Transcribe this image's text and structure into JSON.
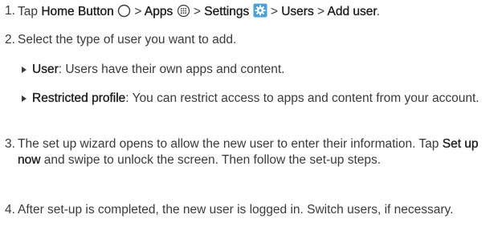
{
  "steps": [
    {
      "number": "1.",
      "parts": {
        "t1": "Tap ",
        "home_button": "Home Button",
        "t2": " > ",
        "apps": "Apps",
        "t3": " > ",
        "settings": "Settings",
        "t4": " > ",
        "users": "Users",
        "t5": " > ",
        "add_user": "Add user",
        "t6": "."
      }
    },
    {
      "number": "2.",
      "text": "Select the type of user you want to add.",
      "subitems": [
        {
          "term": "User",
          "text": ": Users have their own apps and content."
        },
        {
          "term": "Restricted profile",
          "text": ": You can restrict access to apps and content from your account."
        }
      ]
    },
    {
      "number": "3.",
      "t1": "The set up wizard opens to allow the new user to enter their information. Tap ",
      "setup_now": "Set up now",
      "t2": " and swipe to unlock the screen. Then follow the set-up steps."
    },
    {
      "number": "4.",
      "text": "After set-up is completed, the new user is logged in. Switch users, if necessary."
    }
  ],
  "icons": {
    "home": "circle-outline-icon",
    "apps": "apps-grid-icon",
    "settings": "gear-icon",
    "bullet": "triangle-bullet-icon"
  },
  "colors": {
    "text": "#3a3a3a",
    "bold_text": "#1e1e1e",
    "settings_icon_bg": "#4a9fd8"
  }
}
